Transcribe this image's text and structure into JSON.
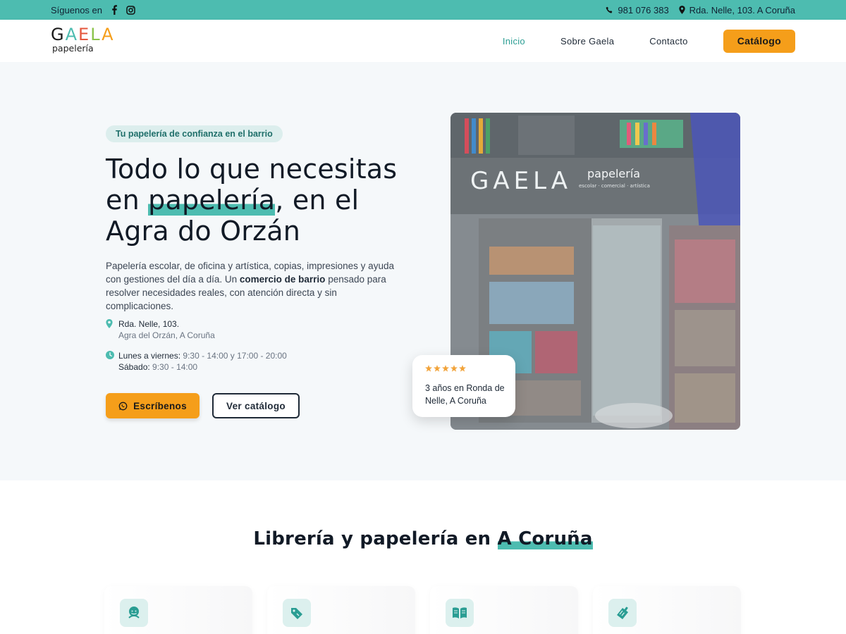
{
  "topbar": {
    "follow_label": "Síguenos en",
    "phone": "981 076 383",
    "address": "Rda. Nelle, 103. A Coruña",
    "bg_color": "#4dbcb0"
  },
  "header": {
    "logo_word": "GAELA",
    "logo_sub": "papelería",
    "nav": [
      {
        "label": "Inicio",
        "active": true
      },
      {
        "label": "Sobre Gaela",
        "active": false
      },
      {
        "label": "Contacto",
        "active": false
      }
    ],
    "cta_label": "Catálogo"
  },
  "hero": {
    "badge": "Tu papelería de confianza en el barrio",
    "title_before": "Todo lo que necesitas en ",
    "title_highlight": "papelería",
    "title_after": ", en el Agra do Orzán",
    "lead_part1": "Papelería escolar, de oficina y artística, copias, impresiones y ayuda con gestiones del día a día. Un ",
    "lead_bold": "comercio de barrio",
    "lead_part2": " pensado para resolver necesidades reales, con atención directa y sin complicaciones.",
    "address_line1": "Rda. Nelle, 103.",
    "address_line2": "Agra del Orzán, A Coruña",
    "hours_weekday_label": "Lunes a viernes:",
    "hours_weekday": " 9:30 - 14:00 y 17:00 - 20:00",
    "hours_saturday_label": "Sábado:",
    "hours_saturday": " 9:30 - 14:00",
    "primary_button": "Escríbenos",
    "secondary_button": "Ver catálogo",
    "photo_sign_text": "papelería",
    "photo_sign_sub": "escolar · comercial · artística",
    "card": {
      "stars": 5,
      "text": "3 años en Ronda de Nelle, A Coruña"
    }
  },
  "section2": {
    "title_before": "Librería y papelería en ",
    "title_highlight": "A Coruña",
    "features": [
      {
        "icon": "support-chat-icon"
      },
      {
        "icon": "price-tag-icon"
      },
      {
        "icon": "open-book-icon"
      },
      {
        "icon": "school-supplies-icon"
      }
    ]
  },
  "colors": {
    "accent_teal": "#4dbcb0",
    "accent_orange": "#f59e1a",
    "text_dark": "#1f2a37"
  }
}
